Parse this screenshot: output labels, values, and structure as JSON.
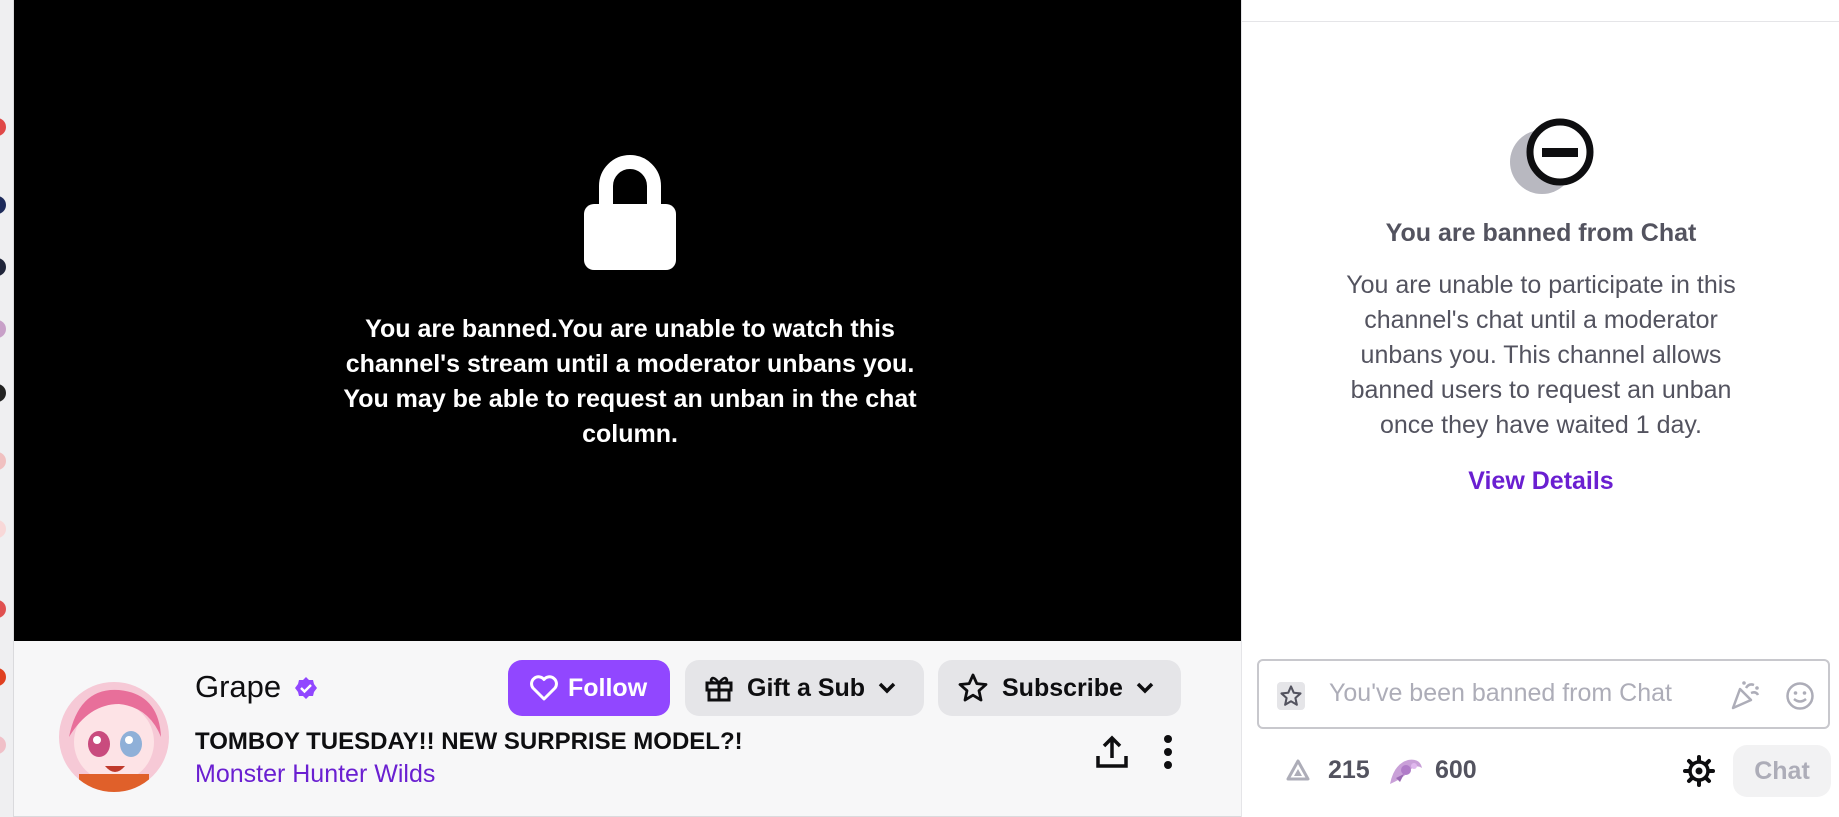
{
  "player": {
    "ban_message": "You are banned.You are unable to watch this channel's stream until a moderator unbans you. You may be able to request an unban in the chat column."
  },
  "channel": {
    "name": "Grape",
    "stream_title": "TOMBOY TUESDAY!! NEW SURPRISE MODEL?!",
    "category": "Monster Hunter Wilds",
    "follow_label": "Follow",
    "gift_label": "Gift a Sub",
    "subscribe_label": "Subscribe"
  },
  "chat": {
    "ban_title": "You are banned from Chat",
    "ban_body": "You are unable to participate in this channel's chat until a moderator unbans you. This channel allows banned users to request an unban once they have waited 1 day.",
    "view_details": "View Details",
    "input_placeholder": "You've been banned from Chat",
    "channel_points": "215",
    "bits": "600",
    "chat_button": "Chat"
  },
  "colors": {
    "accent": "#9147ff",
    "link": "#6a1fd1",
    "player_bg": "#000000",
    "muted_text": "#53535f"
  },
  "icons": [
    "lock-icon",
    "verified-icon",
    "heart-icon",
    "gift-icon",
    "chevron-down-icon",
    "star-icon",
    "share-icon",
    "more-icon",
    "ban-icon",
    "party-icon",
    "emoji-icon",
    "channel-points-icon",
    "bits-icon",
    "gear-icon"
  ]
}
